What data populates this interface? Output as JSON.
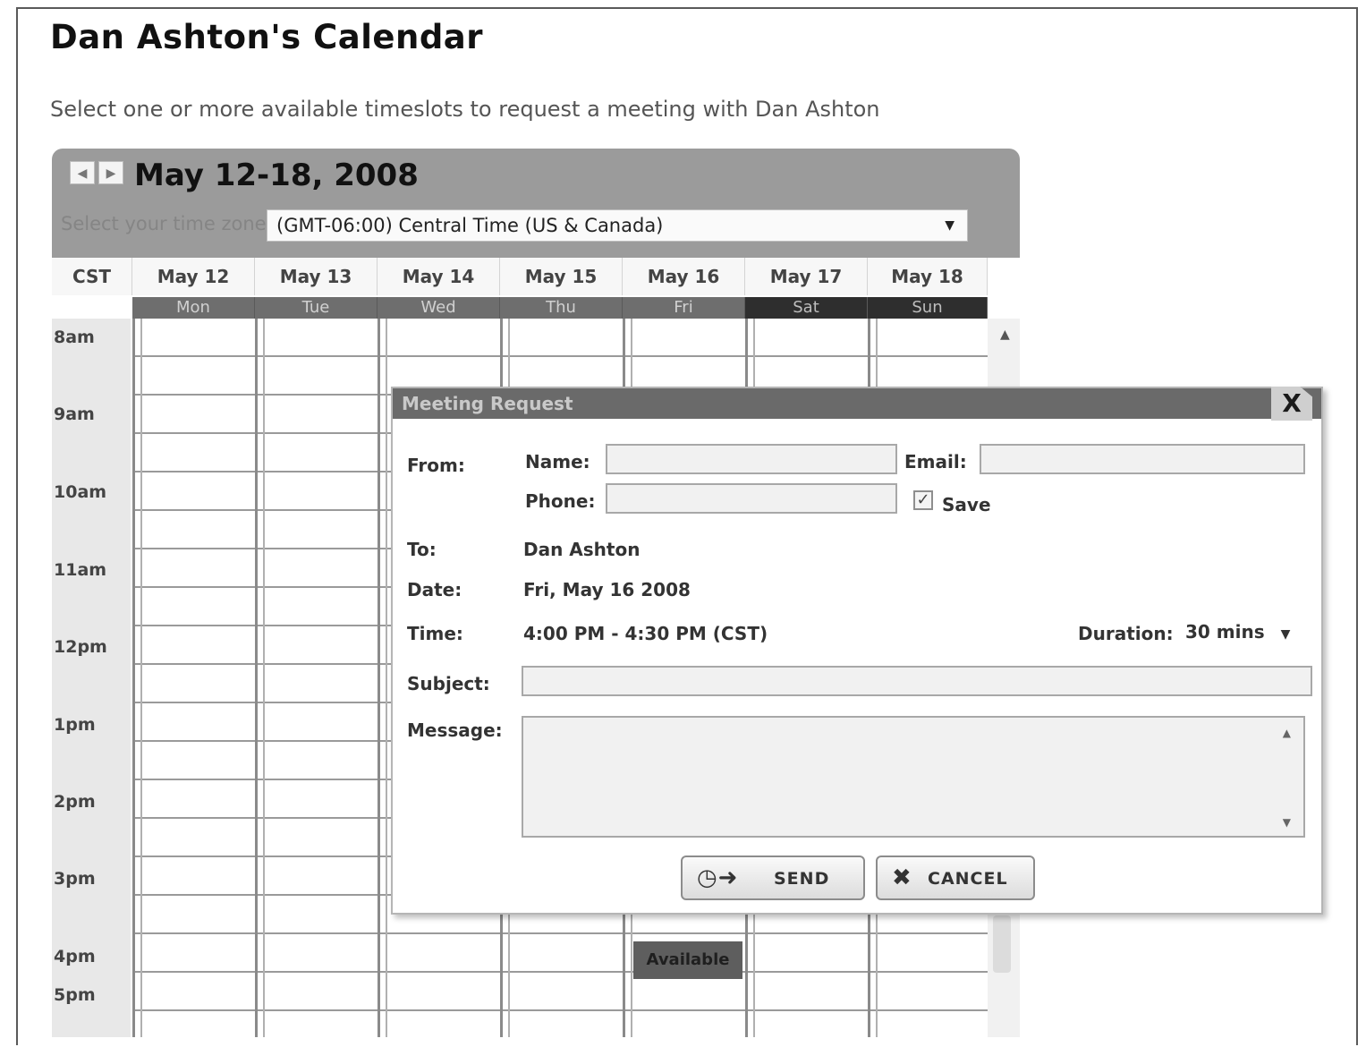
{
  "page": {
    "title": "Dan Ashton's Calendar",
    "subtitle": "Select one or more available timeslots to request a meeting with Dan Ashton"
  },
  "calendar": {
    "prev_icon": "chevron-left-icon",
    "next_icon": "chevron-right-icon",
    "week_range": "May 12-18, 2008",
    "timezone_label": "Select your time zone",
    "timezone_value": "(GMT-06:00) Central Time (US & Canada)",
    "tz_column": "CST",
    "days": [
      {
        "date": "May 12",
        "dow": "Mon"
      },
      {
        "date": "May 13",
        "dow": "Tue"
      },
      {
        "date": "May 14",
        "dow": "Wed"
      },
      {
        "date": "May 15",
        "dow": "Thu"
      },
      {
        "date": "May 16",
        "dow": "Fri"
      },
      {
        "date": "May 17",
        "dow": "Sat"
      },
      {
        "date": "May 18",
        "dow": "Sun"
      }
    ],
    "times": [
      "8am",
      "9am",
      "10am",
      "11am",
      "12pm",
      "1pm",
      "2pm",
      "3pm",
      "4pm",
      "5pm"
    ],
    "available_label": "Available"
  },
  "modal": {
    "title": "Meeting Request",
    "close_label": "X",
    "from_label": "From:",
    "name_label": "Name:",
    "name_value": "",
    "email_label": "Email:",
    "email_value": "",
    "phone_label": "Phone:",
    "phone_value": "",
    "save_label": "Save",
    "save_checked": true,
    "to_label": "To:",
    "to_value": "Dan Ashton",
    "date_label": "Date:",
    "date_value": "Fri, May 16 2008",
    "time_label": "Time:",
    "time_value": "4:00 PM - 4:30 PM (CST)",
    "duration_label": "Duration:",
    "duration_value": "30 mins",
    "subject_label": "Subject:",
    "subject_value": "",
    "message_label": "Message:",
    "message_value": "",
    "send_label": "SEND",
    "cancel_label": "CANCEL"
  },
  "colors": {
    "header_bg": "#9b9b9b",
    "weekday_bar": "#6e6e6e",
    "weekend_bar": "#2e2e2e",
    "modal_title_bg": "#6a6a6a",
    "available_bg": "#5e5e5e"
  }
}
